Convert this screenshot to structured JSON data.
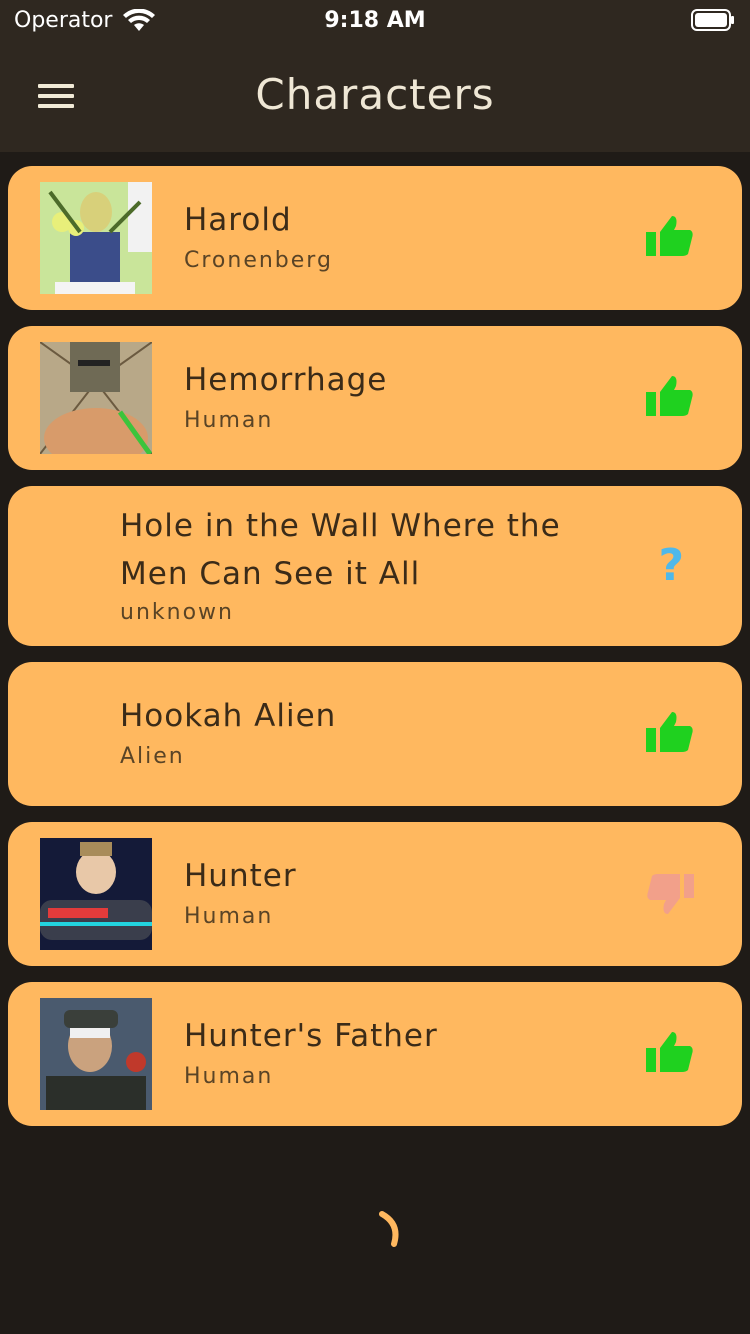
{
  "status_bar": {
    "carrier": "Operator",
    "time": "9:18 AM",
    "wifi_icon": "wifi-icon",
    "battery_icon": "battery-icon"
  },
  "header": {
    "title": "Characters",
    "menu_icon": "hamburger-menu-icon"
  },
  "characters": [
    {
      "name": "Harold",
      "species": "Cronenberg",
      "status": "alive",
      "status_icon": "thumbs-up-icon",
      "has_image": true
    },
    {
      "name": "Hemorrhage",
      "species": "Human",
      "status": "alive",
      "status_icon": "thumbs-up-icon",
      "has_image": true
    },
    {
      "name": "Hole in the Wall Where the Men Can See it All",
      "species": "unknown",
      "status": "unknown",
      "status_icon": "question-mark-icon",
      "status_glyph": "?",
      "has_image": false
    },
    {
      "name": "Hookah Alien",
      "species": "Alien",
      "status": "alive",
      "status_icon": "thumbs-up-icon",
      "has_image": false
    },
    {
      "name": "Hunter",
      "species": "Human",
      "status": "dead",
      "status_icon": "thumbs-down-icon",
      "has_image": true
    },
    {
      "name": "Hunter's Father",
      "species": "Human",
      "status": "alive",
      "status_icon": "thumbs-up-icon",
      "has_image": true
    }
  ],
  "colors": {
    "background": "#1f1b17",
    "header": "#2f2820",
    "card": "#ffb85f",
    "alive": "#1fd11f",
    "dead": "#f2a08a",
    "unknown": "#4fb8ea",
    "spinner": "#ffb85f"
  },
  "loading_icon": "loading-spinner-icon"
}
